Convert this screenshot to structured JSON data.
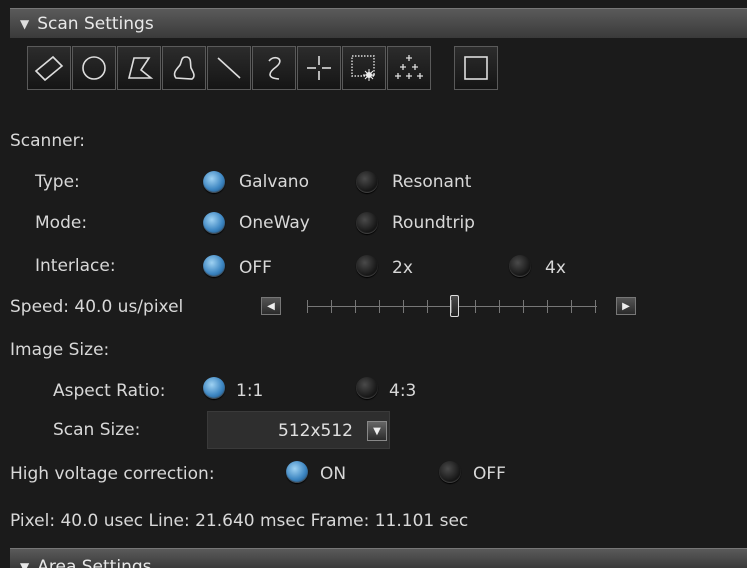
{
  "scan_settings": {
    "title": "Scan Settings"
  },
  "area_settings": {
    "title": "Area Settings"
  },
  "tools": [
    {
      "name": "rectangle-roi-tool",
      "icon": "rotated-rectangle-icon"
    },
    {
      "name": "ellipse-roi-tool",
      "icon": "circle-icon"
    },
    {
      "name": "polygon-roi-tool",
      "icon": "polygon-icon"
    },
    {
      "name": "freehand-roi-tool",
      "icon": "freehand-icon"
    },
    {
      "name": "line-roi-tool",
      "icon": "line-icon"
    },
    {
      "name": "curve-roi-tool",
      "icon": "curve-icon"
    },
    {
      "name": "point-roi-tool",
      "icon": "crosshair-icon"
    },
    {
      "name": "grid-point-tool",
      "icon": "grid-point-icon"
    },
    {
      "name": "multi-point-tool",
      "icon": "multi-point-icon"
    },
    {
      "name": "full-frame-tool",
      "icon": "square-icon"
    }
  ],
  "scanner": {
    "heading": "Scanner:",
    "type": {
      "label": "Type:",
      "options": [
        "Galvano",
        "Resonant"
      ],
      "selected": "Galvano"
    },
    "mode": {
      "label": "Mode:",
      "options": [
        "OneWay",
        "Roundtrip"
      ],
      "selected": "OneWay"
    },
    "interlace": {
      "label": "Interlace:",
      "options": [
        "OFF",
        "2x",
        "4x"
      ],
      "selected": "OFF"
    }
  },
  "speed": {
    "label": "Speed:  40.0 us/pixel"
  },
  "image_size": {
    "heading": "Image Size:",
    "aspect_ratio": {
      "label": "Aspect Ratio:",
      "options": [
        "1:1",
        "4:3"
      ],
      "selected": "1:1"
    },
    "scan_size": {
      "label": "Scan Size:",
      "value": "512x512"
    }
  },
  "hv_correction": {
    "label": "High voltage correction:",
    "options": [
      "ON",
      "OFF"
    ],
    "selected": "ON"
  },
  "status": "Pixel: 40.0 usec Line: 21.640 msec Frame: 11.101 sec",
  "colors": {
    "radio_on": "#3d86c2",
    "background": "#1b1b1b",
    "header": "#4a4a4a"
  }
}
